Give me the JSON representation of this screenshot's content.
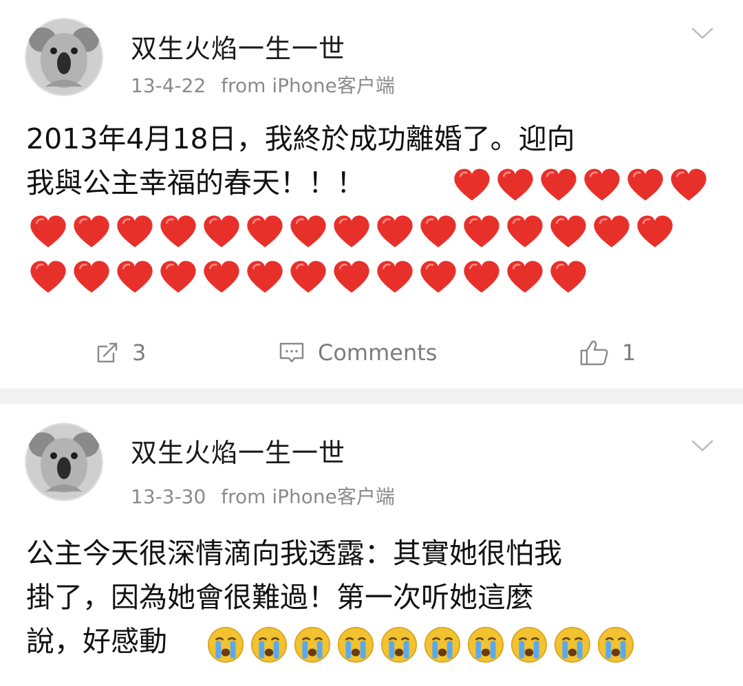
{
  "posts": [
    {
      "username": "双生火焰一生一世",
      "date": "13-4-22",
      "source": "from iPhone客户端",
      "text_line1": "2013年4月18日，我終於成功離婚了。迎向",
      "text_line2": "我與公主幸福的春天！！！",
      "emoji": "red-heart-icon",
      "emoji_count": 34,
      "actions": {
        "repost_count": "3",
        "comments_label": "Comments",
        "like_count": "1"
      }
    },
    {
      "username": "双生火焰一生一世",
      "date": "13-3-30",
      "source": "from iPhone客户端",
      "text_line1": "公主今天很深情滴向我透露：其實她很怕我",
      "text_line2": "掛了，因為她會很難過！第一次听她這麼",
      "text_line3": "說，好感動",
      "emoji": "crying-face-icon",
      "emoji_count": 10
    }
  ],
  "colors": {
    "heart": "#e8302b",
    "crying_face": "#f2c230",
    "tears": "#5aa9ee",
    "meta_gray": "#8a8a8a"
  }
}
